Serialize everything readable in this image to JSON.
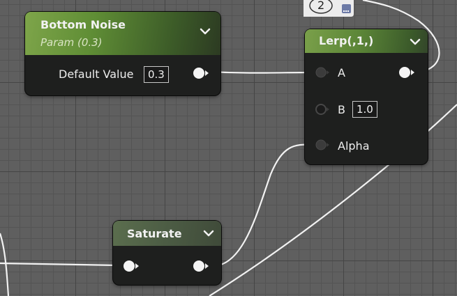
{
  "nodes": {
    "bottom_noise": {
      "title": "Bottom Noise",
      "subtitle": "Param (0.3)",
      "param_label": "Default Value",
      "param_value": "0.3"
    },
    "lerp": {
      "title": "Lerp(,1,)",
      "inputs": {
        "a": "A",
        "b": "B",
        "alpha": "Alpha"
      },
      "b_value": "1.0"
    },
    "saturate": {
      "title": "Saturate"
    }
  },
  "comment_bubble": {
    "count": "2"
  },
  "colors": {
    "param_header": "#6f9a40",
    "lerp_header": "#6a9440",
    "saturate_header": "#505f47",
    "wire": "#f2f2f2",
    "canvas": "#5f5f5f"
  },
  "icons": [
    "chevron-down-icon",
    "comment-icon",
    "exec-pin-icon"
  ]
}
